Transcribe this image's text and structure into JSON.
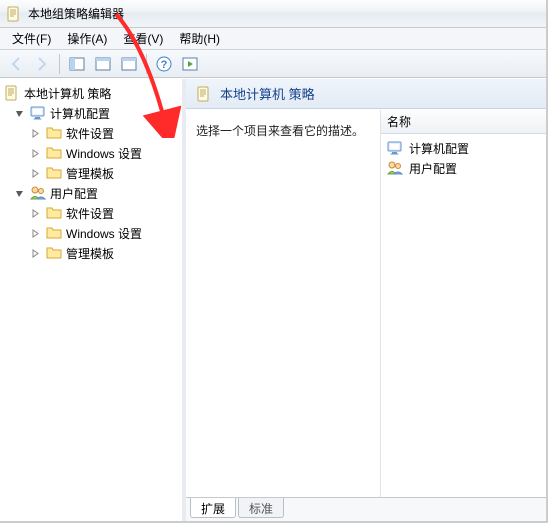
{
  "window": {
    "title": "本地组策略编辑器"
  },
  "menu": {
    "file": "文件(F)",
    "action": "操作(A)",
    "view": "查看(V)",
    "help": "帮助(H)"
  },
  "tree": {
    "root": "本地计算机 策略",
    "computer": "计算机配置",
    "user": "用户配置",
    "software": "软件设置",
    "windows": "Windows 设置",
    "templates": "管理模板"
  },
  "detail": {
    "title": "本地计算机 策略",
    "hint": "选择一个项目来查看它的描述。",
    "col_name": "名称",
    "items": {
      "computer": "计算机配置",
      "user": "用户配置"
    }
  },
  "tabs": {
    "extended": "扩展",
    "standard": "标准"
  }
}
